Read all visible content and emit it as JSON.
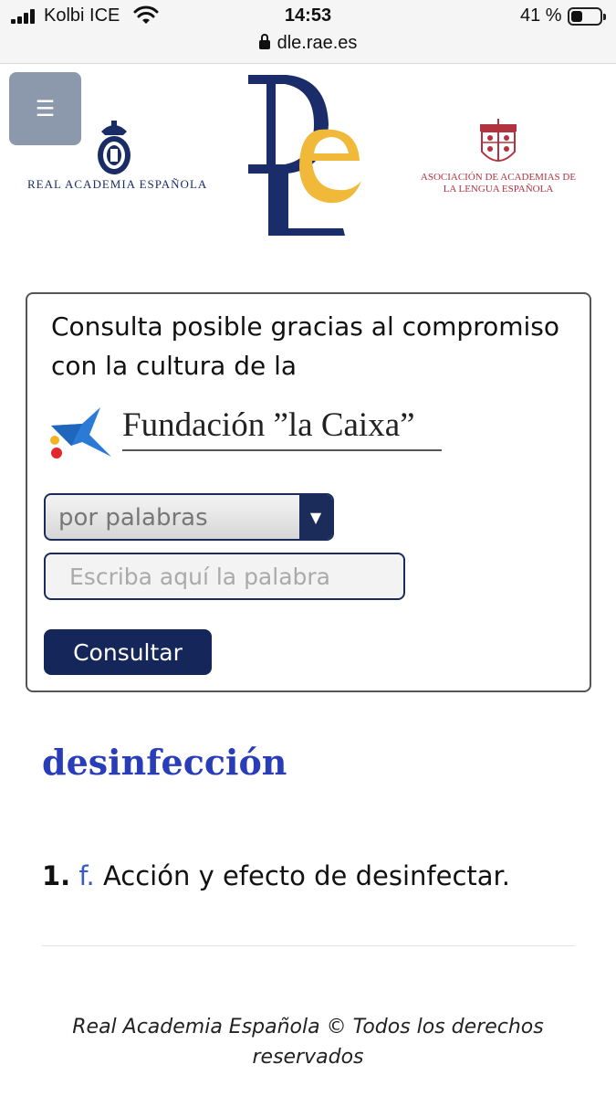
{
  "status_bar": {
    "carrier": "Kolbi ICE",
    "time": "14:53",
    "battery_percent_label": "41 %",
    "battery_level": 0.41,
    "url": "dle.rae.es"
  },
  "header": {
    "menu_icon": "☰",
    "rae_name": "REAL ACADEMIA ESPAÑOLA",
    "asale_name": "ASOCIACIÓN DE ACADEMIAS DE LA LENGUA ESPAÑOLA"
  },
  "search": {
    "sponsor_text": "Consulta posible gracias al compromiso con la cultura de la",
    "sponsor_name": "Fundación ”la Caixa”",
    "mode_value": "por palabras",
    "input_value": "",
    "input_placeholder": "Escriba aquí la palabra",
    "submit_label": "Consultar"
  },
  "entry": {
    "word": "desinfección",
    "definitions": [
      {
        "number": "1.",
        "abbr": "f.",
        "text": " Acción y efecto de desinfectar."
      }
    ]
  },
  "footer": {
    "text": "Real Academia Española © Todos los derechos reservados"
  },
  "colors": {
    "menu_button": "#8c99ac",
    "navy": "#15275a",
    "entry_blue": "#2a3db8",
    "logo_gold": "#f0b93a",
    "asale_red": "#b2333f"
  },
  "icons": [
    "signal-icon",
    "wifi-icon",
    "lock-icon",
    "battery-icon",
    "hamburger-menu-icon",
    "rae-crest-icon",
    "dle-logo",
    "asale-crest-icon",
    "caixa-star-logo",
    "dropdown-arrow-icon"
  ]
}
